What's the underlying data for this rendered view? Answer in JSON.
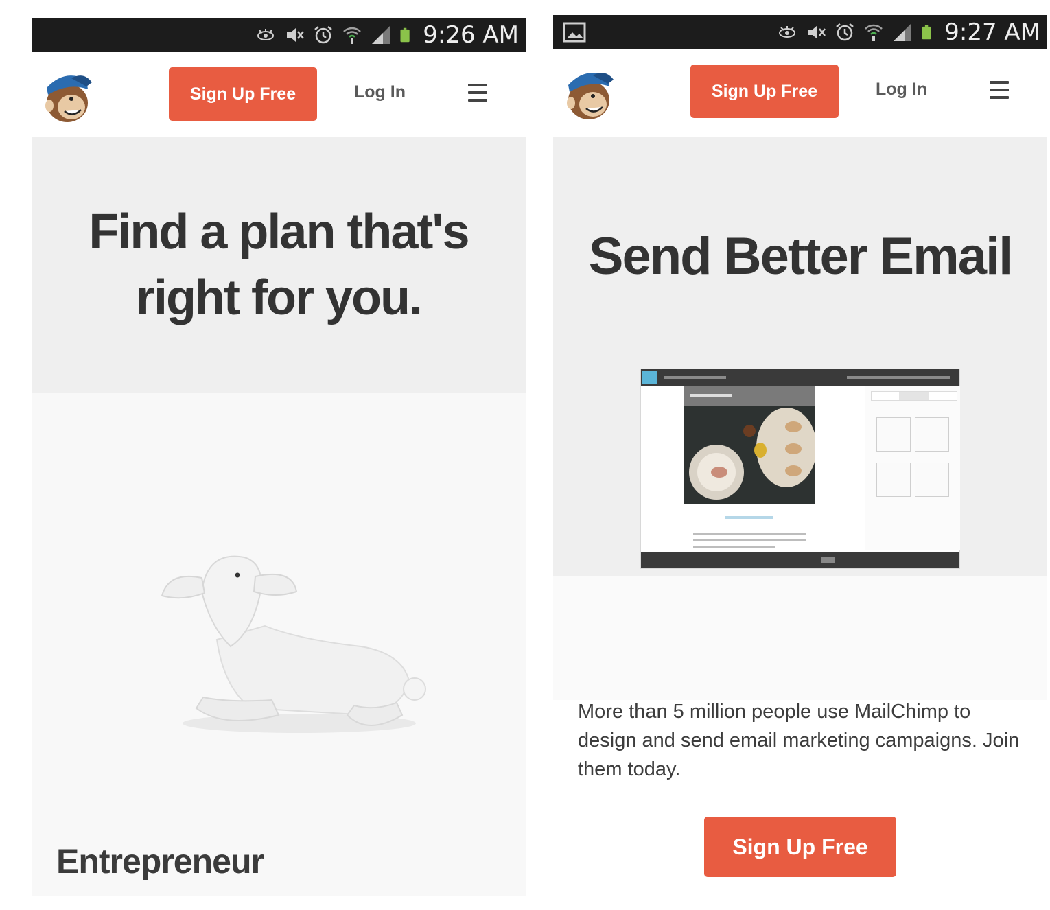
{
  "screens": [
    {
      "status_bar": {
        "time": "9:26 AM",
        "icons": [
          "eye-icon",
          "mute-icon",
          "alarm-icon",
          "wifi-icon",
          "signal-icon",
          "battery-icon"
        ]
      },
      "nav": {
        "signup_label": "Sign Up Free",
        "login_label": "Log In",
        "menu_icon": "hamburger-menu-icon",
        "logo": "freddie-chimp-logo"
      },
      "hero": {
        "headline": "Find a plan that's right for you."
      },
      "plan": {
        "name": "Entrepreneur",
        "image": "lamb-figurine"
      }
    },
    {
      "status_bar": {
        "time": "9:27 AM",
        "icons": [
          "gallery-icon",
          "eye-icon",
          "mute-icon",
          "alarm-icon",
          "wifi-icon",
          "signal-icon",
          "battery-icon"
        ]
      },
      "nav": {
        "signup_label": "Sign Up Free",
        "login_label": "Log In",
        "menu_icon": "hamburger-menu-icon",
        "logo": "freddie-chimp-logo"
      },
      "hero": {
        "headline": "Send Better Email",
        "image": "campaign-editor-screenshot"
      },
      "body": {
        "description": "More than 5 million people use MailChimp to design and send email marketing campaigns. Join them today."
      },
      "cta": {
        "label": "Sign Up Free"
      }
    }
  ],
  "colors": {
    "accent": "#e85c41",
    "statusbar": "#1c1c1c",
    "hero_bg": "#efefef",
    "battery": "#8bc34a",
    "text": "#333333"
  }
}
